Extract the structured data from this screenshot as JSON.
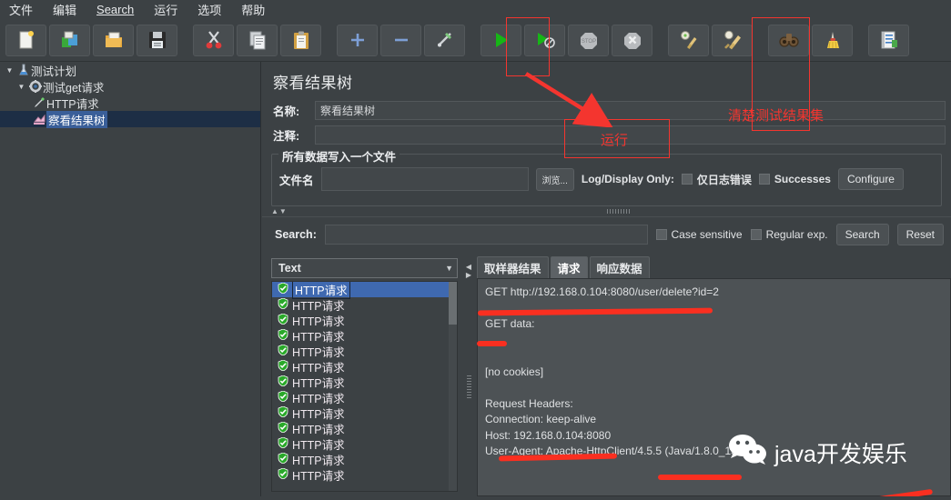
{
  "menu": {
    "items": [
      {
        "label": "文件",
        "underlined": false
      },
      {
        "label": "编辑",
        "underlined": false
      },
      {
        "label": "Search",
        "underlined": true
      },
      {
        "label": "运行",
        "underlined": false
      },
      {
        "label": "选项",
        "underlined": false
      },
      {
        "label": "帮助",
        "underlined": false
      }
    ]
  },
  "toolbar": {
    "buttons": [
      {
        "name": "new-icon",
        "title": "新建"
      },
      {
        "name": "templates-icon",
        "title": "模板"
      },
      {
        "name": "open-icon",
        "title": "打开"
      },
      {
        "name": "save-icon",
        "title": "保存"
      },
      {
        "name": "cut-icon",
        "title": "剪切"
      },
      {
        "name": "copy-icon",
        "title": "复制"
      },
      {
        "name": "paste-icon",
        "title": "粘贴"
      },
      {
        "name": "expand-all-icon",
        "title": "展开"
      },
      {
        "name": "collapse-all-icon",
        "title": "收起"
      },
      {
        "name": "toggle-icon",
        "title": "启用/禁用"
      },
      {
        "name": "start-icon",
        "title": "运行"
      },
      {
        "name": "start-no-pauses-icon",
        "title": "无间隔运行"
      },
      {
        "name": "stop-icon",
        "title": "停止"
      },
      {
        "name": "shutdown-icon",
        "title": "关闭"
      },
      {
        "name": "clear-icon",
        "title": "清除"
      },
      {
        "name": "clear-all-icon",
        "title": "清除全部"
      },
      {
        "name": "search-icon",
        "title": "搜索"
      },
      {
        "name": "search-reset-icon",
        "title": "重置搜索"
      },
      {
        "name": "function-helper-icon",
        "title": "函数助手"
      }
    ]
  },
  "tree": {
    "nodes": [
      {
        "label": "测试计划",
        "icon": "test-plan-icon",
        "level": 1,
        "twisty": "▼",
        "selected": false
      },
      {
        "label": "测试get请求",
        "icon": "thread-group-icon",
        "level": 2,
        "twisty": "▼",
        "selected": false
      },
      {
        "label": "HTTP请求",
        "icon": "http-sampler-icon",
        "level": 3,
        "twisty": "",
        "selected": false
      },
      {
        "label": "察看结果树",
        "icon": "view-results-tree-icon",
        "level": 3,
        "twisty": "",
        "selected": true
      }
    ]
  },
  "panel": {
    "title": "察看结果树",
    "name_label": "名称:",
    "name_value": "察看结果树",
    "comment_label": "注释:",
    "comment_value": "",
    "group_title": "所有数据写入一个文件",
    "filename_label": "文件名",
    "filename_value": "",
    "browse_button": "浏览...",
    "logdisplay_label": "Log/Display Only:",
    "errors_checkbox": "仅日志错误",
    "successes_checkbox": "Successes",
    "configure_button": "Configure"
  },
  "search": {
    "label": "Search:",
    "value": "",
    "case_sensitive": "Case sensitive",
    "regular_exp": "Regular exp.",
    "search_button": "Search",
    "reset_button": "Reset"
  },
  "results": {
    "renderer_selected": "Text",
    "entries": [
      {
        "label": "HTTP请求",
        "status": "success",
        "selected": true
      },
      {
        "label": "HTTP请求",
        "status": "success",
        "selected": false
      },
      {
        "label": "HTTP请求",
        "status": "success",
        "selected": false
      },
      {
        "label": "HTTP请求",
        "status": "success",
        "selected": false
      },
      {
        "label": "HTTP请求",
        "status": "success",
        "selected": false
      },
      {
        "label": "HTTP请求",
        "status": "success",
        "selected": false
      },
      {
        "label": "HTTP请求",
        "status": "success",
        "selected": false
      },
      {
        "label": "HTTP请求",
        "status": "success",
        "selected": false
      },
      {
        "label": "HTTP请求",
        "status": "success",
        "selected": false
      },
      {
        "label": "HTTP请求",
        "status": "success",
        "selected": false
      },
      {
        "label": "HTTP请求",
        "status": "success",
        "selected": false
      },
      {
        "label": "HTTP请求",
        "status": "success",
        "selected": false
      },
      {
        "label": "HTTP请求",
        "status": "success",
        "selected": false
      }
    ],
    "tabs": [
      {
        "label": "取样器结果",
        "active": false
      },
      {
        "label": "请求",
        "active": true
      },
      {
        "label": "响应数据",
        "active": false
      }
    ],
    "request_text": [
      "GET http://192.168.0.104:8080/user/delete?id=2",
      "",
      "GET data:",
      "",
      "",
      "[no cookies]",
      "",
      "Request Headers:",
      "Connection: keep-alive",
      "Host: 192.168.0.104:8080",
      "User-Agent: Apache-HttpClient/4.5.5 (Java/1.8.0_131)"
    ]
  },
  "annotations": {
    "run_label": "运行",
    "clear_label": "清楚测试结果集",
    "color": "#f4352f"
  },
  "watermark": {
    "text": "java开发娱乐",
    "icon": "wechat-icon"
  }
}
